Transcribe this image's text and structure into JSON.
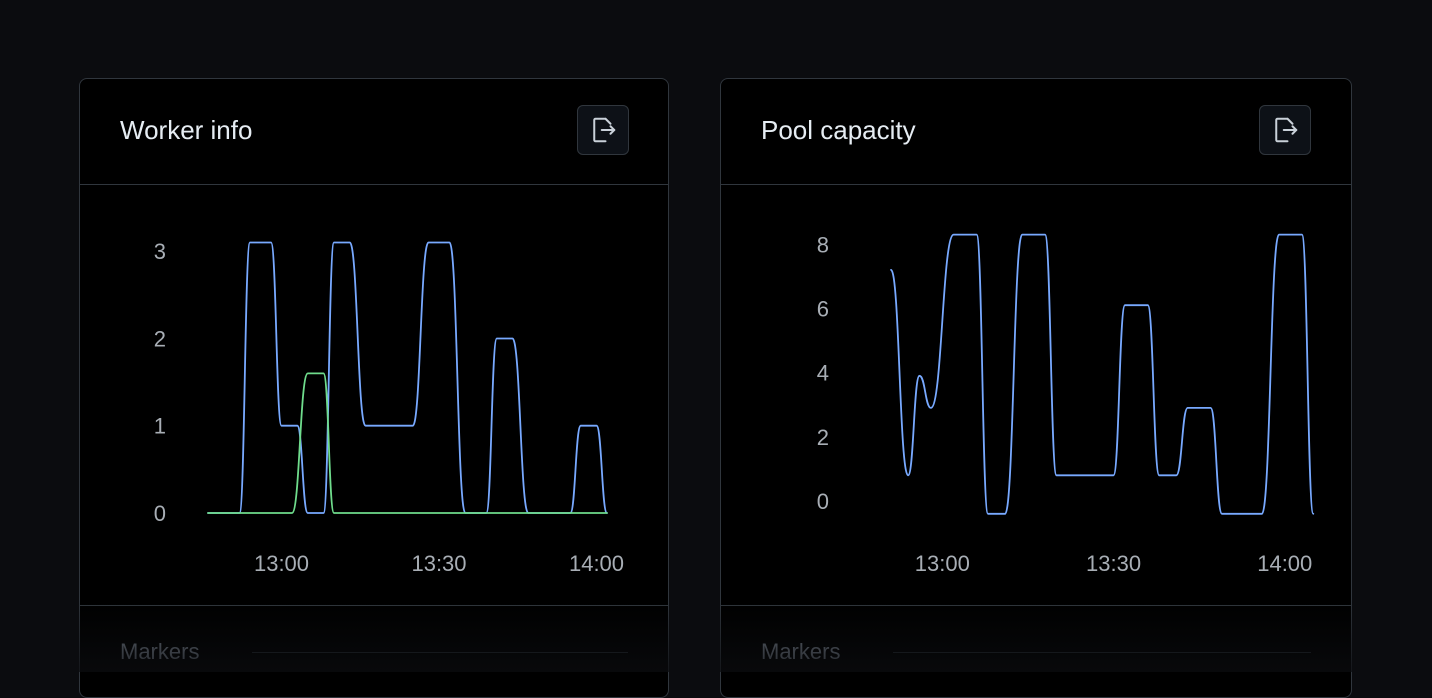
{
  "panels": [
    {
      "title": "Worker info",
      "markers_label": "Markers",
      "export_icon": "export-file-icon"
    },
    {
      "title": "Pool capacity",
      "markers_label": "Markers",
      "export_icon": "export-file-icon"
    }
  ],
  "colors": {
    "series_blue": "#78a9ff",
    "series_green": "#6fdc8c",
    "tick": "#a8aeb5",
    "border": "#30363d"
  },
  "chart_data": [
    {
      "type": "line",
      "title": "Worker info",
      "x_ticks": [
        "13:00",
        "13:30",
        "14:00"
      ],
      "x_tick_minutes": [
        0,
        30,
        60
      ],
      "xlim": [
        -14,
        66
      ],
      "y_ticks": [
        0,
        1,
        2,
        3
      ],
      "ylim": [
        0,
        3.3
      ],
      "grid": false,
      "series": [
        {
          "color": "#78a9ff",
          "points": [
            [
              -14,
              0
            ],
            [
              -8,
              0
            ],
            [
              -6,
              3.1
            ],
            [
              -2,
              3.1
            ],
            [
              0,
              1
            ],
            [
              3,
              1
            ],
            [
              5,
              0
            ],
            [
              8,
              0
            ],
            [
              10,
              3.1
            ],
            [
              13,
              3.1
            ],
            [
              16,
              1
            ],
            [
              25,
              1
            ],
            [
              28,
              3.1
            ],
            [
              32,
              3.1
            ],
            [
              35,
              0
            ],
            [
              39,
              0
            ],
            [
              41,
              2.0
            ],
            [
              44,
              2.0
            ],
            [
              47,
              0
            ],
            [
              55,
              0
            ],
            [
              57,
              1
            ],
            [
              60,
              1
            ],
            [
              62,
              0
            ]
          ]
        },
        {
          "color": "#6fdc8c",
          "points": [
            [
              -14,
              0
            ],
            [
              2,
              0
            ],
            [
              5,
              1.6
            ],
            [
              8,
              1.6
            ],
            [
              10,
              0
            ],
            [
              62,
              0
            ]
          ]
        }
      ]
    },
    {
      "type": "line",
      "title": "Pool capacity",
      "x_ticks": [
        "13:00",
        "13:30",
        "14:00"
      ],
      "x_tick_minutes": [
        0,
        30,
        60
      ],
      "xlim": [
        -16,
        66
      ],
      "y_ticks": [
        0,
        2,
        4,
        6,
        8
      ],
      "ylim": [
        -0.5,
        8.6
      ],
      "grid": false,
      "series": [
        {
          "color": "#78a9ff",
          "points": [
            [
              -9,
              7.2
            ],
            [
              -6,
              0.8
            ],
            [
              -4,
              3.9
            ],
            [
              -2,
              2.9
            ],
            [
              2,
              8.3
            ],
            [
              6,
              8.3
            ],
            [
              8,
              -0.4
            ],
            [
              11,
              -0.4
            ],
            [
              14,
              8.3
            ],
            [
              18,
              8.3
            ],
            [
              20,
              0.8
            ],
            [
              30,
              0.8
            ],
            [
              32,
              6.1
            ],
            [
              36,
              6.1
            ],
            [
              38,
              0.8
            ],
            [
              41,
              0.8
            ],
            [
              43,
              2.9
            ],
            [
              47,
              2.9
            ],
            [
              49,
              -0.4
            ],
            [
              56,
              -0.4
            ],
            [
              59,
              8.3
            ],
            [
              63,
              8.3
            ],
            [
              65,
              -0.4
            ]
          ]
        }
      ]
    }
  ]
}
